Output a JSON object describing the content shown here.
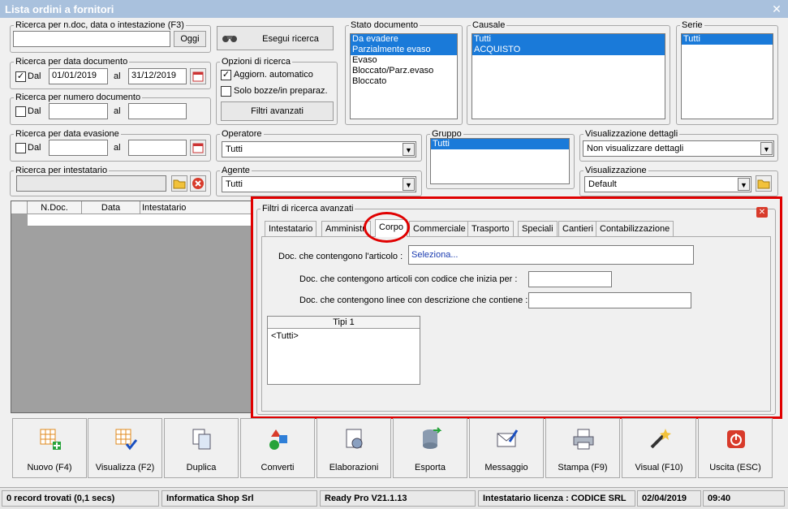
{
  "window": {
    "title": "Lista ordini a fornitori"
  },
  "search_text": {
    "legend": "Ricerca per n.doc, data o intestazione (F3)",
    "value": "",
    "ok_label": "Oggi"
  },
  "exec_search": {
    "label": "Esegui ricerca"
  },
  "date_doc": {
    "legend": "Ricerca per data documento",
    "from_label": "Dal",
    "from": "01/01/2019",
    "to_label": "al",
    "to": "31/12/2019",
    "checked": "✓"
  },
  "options": {
    "legend": "Opzioni di ricerca",
    "auto": "Aggiorn. automatico",
    "auto_checked": "✓",
    "draft": "Solo bozze/in preparaz.",
    "advanced": "Filtri avanzati"
  },
  "doc_number": {
    "legend": "Ricerca per numero documento",
    "from_label": "Dal",
    "to_label": "al"
  },
  "eva_date": {
    "legend": "Ricerca per data evasione",
    "from_label": "Dal",
    "to_label": "al"
  },
  "holder": {
    "legend": "Ricerca per intestatario"
  },
  "stato": {
    "legend": "Stato documento",
    "items": [
      "Da evadere",
      "Parzialmente evaso",
      "Evaso",
      "Bloccato/Parz.evaso",
      "Bloccato"
    ]
  },
  "causale": {
    "legend": "Causale",
    "items": [
      "Tutti",
      "ACQUISTO"
    ]
  },
  "serie": {
    "legend": "Serie",
    "items": [
      "Tutti"
    ]
  },
  "operatore": {
    "legend": "Operatore",
    "value": "Tutti"
  },
  "agente": {
    "legend": "Agente",
    "value": "Tutti"
  },
  "gruppo": {
    "legend": "Gruppo",
    "items": [
      "Tutti"
    ]
  },
  "vis_dettagli": {
    "legend": "Visualizzazione dettagli",
    "value": "Non visualizzare dettagli"
  },
  "visualizzazione": {
    "legend": "Visualizzazione",
    "value": "Default"
  },
  "grid": {
    "columns": [
      "N.Doc.",
      "Data",
      "Intestatario"
    ]
  },
  "filters": {
    "legend": "Filtri di ricerca avanzati",
    "tabs": [
      "Intestatario",
      "Amministr.",
      "Corpo",
      "Commerciale",
      "Trasporto",
      "Speciali",
      "Cantieri",
      "Contabilizzazione"
    ],
    "art_label": "Doc. che contengono l'articolo :",
    "art_value": "Seleziona...",
    "code_label": "Doc. che contengono articoli con codice che inizia per :",
    "desc_label": "Doc. che contengono linee con descrizione che contiene :",
    "tipi_header": "Tipi 1",
    "tipi_item": "<Tutti>"
  },
  "toolbar": [
    "Nuovo (F4)",
    "Visualizza (F2)",
    "Duplica",
    "Converti",
    "Elaborazioni",
    "Esporta",
    "Messaggio",
    "Stampa (F9)",
    "Visual (F10)",
    "Uscita (ESC)"
  ],
  "status": {
    "records": "0 record trovati (0,1 secs)",
    "company": "Informatica Shop Srl",
    "version": "Ready Pro V21.1.13",
    "license": "Intestatario licenza : CODICE SRL",
    "date": "02/04/2019",
    "time": "09:40"
  },
  "colors": {
    "selection": "#1a7ad9",
    "highlight": "#e00000",
    "title_bg": "#a9c1dd"
  }
}
